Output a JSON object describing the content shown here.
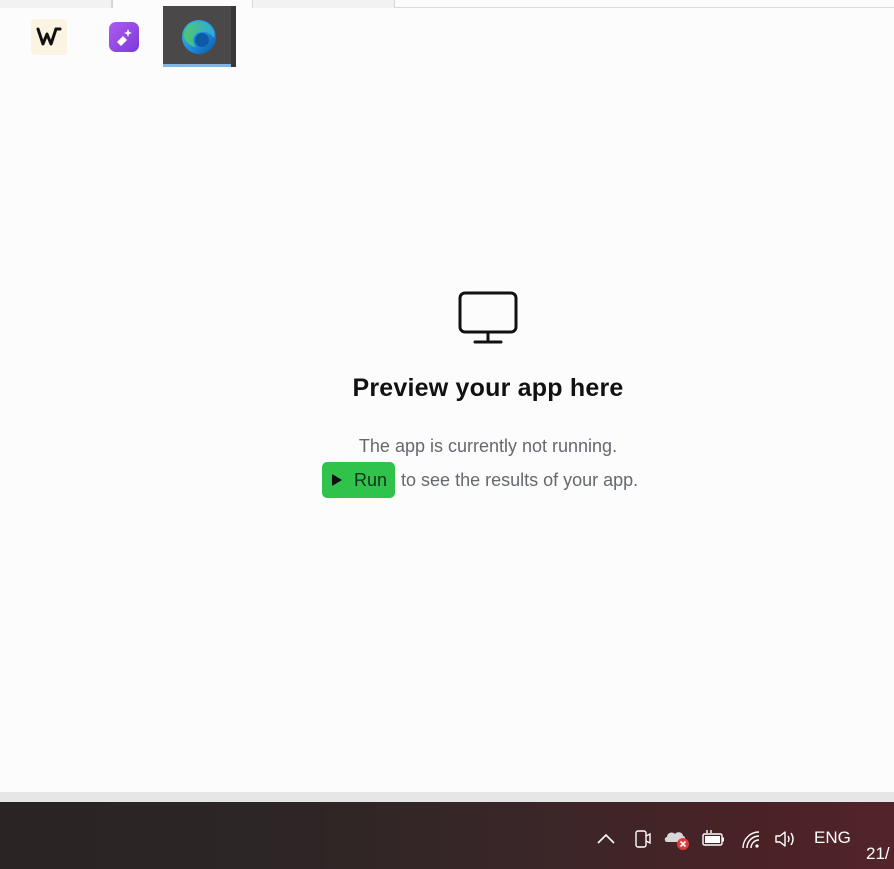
{
  "preview": {
    "title": "Preview your app here",
    "subtitle": "The app is currently not running.",
    "run_label": "Run",
    "run_suffix": "to see the results of your app.",
    "run_color": "#2fc34c"
  },
  "taskbar": {
    "apps": [
      {
        "icon": "writer-app-icon"
      },
      {
        "icon": "sparkle-app-icon"
      },
      {
        "icon": "edge-browser-icon",
        "active": true
      }
    ],
    "tray": {
      "language": "ENG",
      "clock_partial": "21/"
    }
  }
}
